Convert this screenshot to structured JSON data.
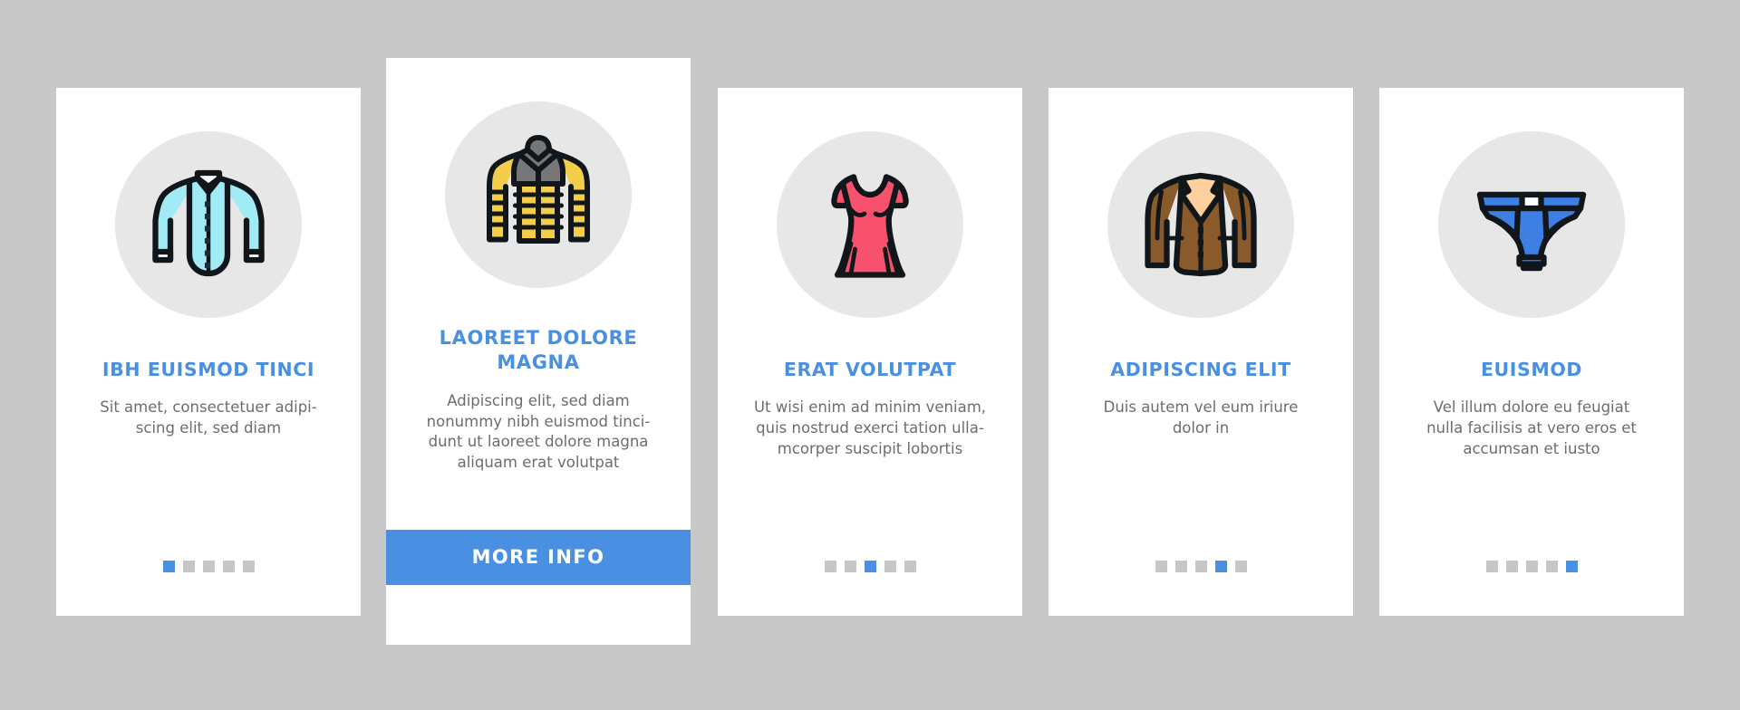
{
  "page": {
    "background_color": "#c8c8c8",
    "card_background": "#ffffff",
    "accent_color": "#4a90e2",
    "title_color": "#4a90e2",
    "body_color": "#6d6d6d",
    "dot_inactive_color": "#c6c6c6",
    "icon_circle_color": "#e7e7e7"
  },
  "cards": [
    {
      "id": "card-1",
      "icon_name": "dress-shirt-icon",
      "title": "IBH EUISMOD TINCI",
      "body": "Sit amet, consectetuer adipi-\nscing elit, sed diam",
      "dots_total": 5,
      "dots_active_index": 1,
      "featured": false,
      "button_label": null
    },
    {
      "id": "card-2",
      "icon_name": "puffer-jacket-icon",
      "title": "LAOREET DOLORE MAGNA",
      "body": "Adipiscing elit, sed diam\nnonummy nibh euismod tinci-\ndunt ut laoreet dolore magna\naliquam erat volutpat",
      "dots_total": 0,
      "dots_active_index": 0,
      "featured": true,
      "button_label": "MORE INFO"
    },
    {
      "id": "card-3",
      "icon_name": "dress-icon",
      "title": "ERAT VOLUTPAT",
      "body": "Ut wisi enim ad minim veniam,\nquis nostrud exerci tation ulla-\nmcorper suscipit lobortis",
      "dots_total": 5,
      "dots_active_index": 3,
      "featured": false,
      "button_label": null
    },
    {
      "id": "card-4",
      "icon_name": "suit-blazer-icon",
      "title": "ADIPISCING ELIT",
      "body": "Duis autem vel eum iriure\ndolor in",
      "dots_total": 5,
      "dots_active_index": 4,
      "featured": false,
      "button_label": null
    },
    {
      "id": "card-5",
      "icon_name": "briefs-underwear-icon",
      "title": "EUISMOD",
      "body": "Vel illum dolore eu feugiat\nnulla facilisis at vero eros et\naccumsan et iusto",
      "dots_total": 5,
      "dots_active_index": 5,
      "featured": false,
      "button_label": null
    }
  ],
  "icon_colors": {
    "shirt_fill": "#a0ebf5",
    "shirt_outline": "#10161a",
    "jacket_body": "#f2ce4b",
    "jacket_shoulder": "#77777a",
    "jacket_outline": "#10161a",
    "dress_fill": "#f7516d",
    "dress_outline": "#10161a",
    "blazer_fill": "#8b5a2b",
    "blazer_lapel": "#ffcf9e",
    "blazer_outline": "#10161a",
    "briefs_fill": "#3d7fe3",
    "briefs_white": "#ffffff",
    "briefs_outline": "#10161a"
  }
}
